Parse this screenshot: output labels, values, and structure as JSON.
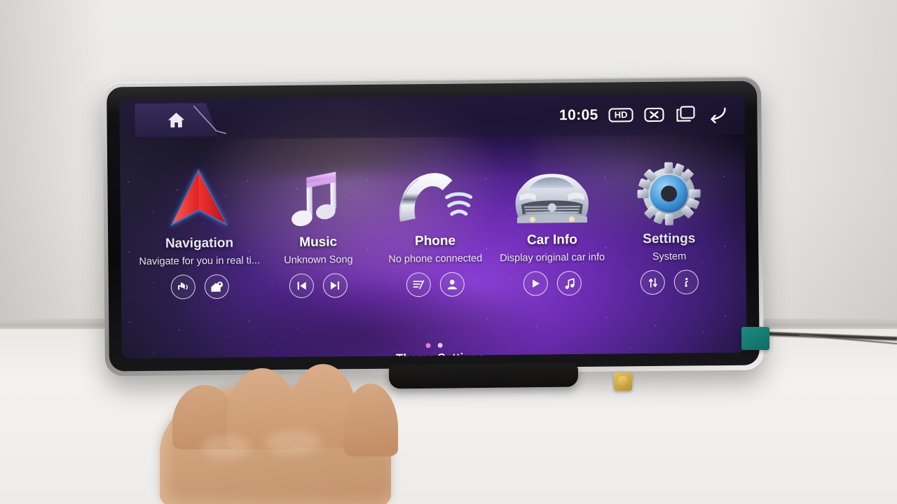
{
  "scene": {
    "description": "Mercedes-Benz Android car head unit display on a white desk, hand in foreground",
    "surface_color": "#efedea",
    "bezel_color": "#b9b7b4",
    "connector_color": "#1d8b80",
    "stand_fitting_color": "#d9b84b"
  },
  "statusbar": {
    "home_icon": "home-icon",
    "clock": "10:05",
    "hd_badge": "HD",
    "mute_icon": "mute-x-icon",
    "windows_icon": "recent-apps-icon",
    "back_icon": "back-arrow-icon"
  },
  "apps": [
    {
      "title": "Navigation",
      "subtitle": "Navigate for you in real ti...",
      "icon": "navigation-arrow-icon",
      "actions": [
        {
          "name": "navigation-voice-button",
          "icon": "turn-voice-icon"
        },
        {
          "name": "navigation-home-button",
          "icon": "home-pin-icon"
        }
      ]
    },
    {
      "title": "Music",
      "subtitle": "Unknown Song",
      "icon": "music-note-icon",
      "actions": [
        {
          "name": "music-previous-button",
          "icon": "previous-track-icon"
        },
        {
          "name": "music-next-button",
          "icon": "next-track-icon"
        }
      ]
    },
    {
      "title": "Phone",
      "subtitle": "No phone connected",
      "icon": "phone-handset-icon",
      "actions": [
        {
          "name": "phone-call-log-button",
          "icon": "call-log-icon"
        },
        {
          "name": "phone-contacts-button",
          "icon": "contact-person-icon"
        }
      ]
    },
    {
      "title": "Car Info",
      "subtitle": "Display original car info",
      "icon": "car-front-icon",
      "actions": [
        {
          "name": "carinfo-play-button",
          "icon": "play-icon"
        },
        {
          "name": "carinfo-sound-button",
          "icon": "music-note-small-icon"
        }
      ]
    },
    {
      "title": "Settings",
      "subtitle": "System",
      "icon": "gear-icon",
      "actions": [
        {
          "name": "settings-transfer-button",
          "icon": "up-down-arrows-icon"
        },
        {
          "name": "settings-info-button",
          "icon": "info-icon"
        }
      ]
    }
  ],
  "pagination": {
    "dots": 2,
    "active_index": 0,
    "active_color": "#e27fd0",
    "inactive_color": "#d8c9ee"
  },
  "theme_bar": {
    "caret": "▼",
    "label": "Theme Settings"
  },
  "colors": {
    "wallpaper_purple": "#6a2bb0",
    "wallpaper_deep": "#241a44",
    "accent_pink": "#e27fd0",
    "text_primary": "#ffffff",
    "text_secondary": "#ece6f8"
  }
}
